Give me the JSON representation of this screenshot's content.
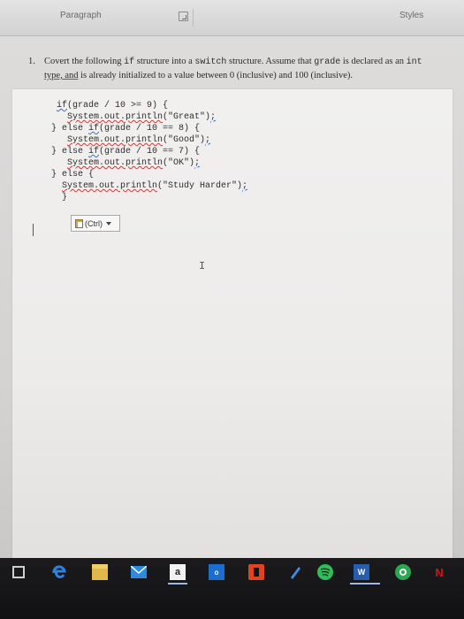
{
  "ribbon": {
    "paragraph_label": "Paragraph",
    "styles_label": "Styles"
  },
  "question": {
    "number": "1.",
    "text_part1": "Covert the following ",
    "if_code": "if",
    "text_part2": " structure into a ",
    "switch_code": "switch",
    "text_part3": " structure. Assume that ",
    "grade_code": "grade",
    "text_part4": " is declared as an ",
    "int_code": "int",
    "text_part5": " type, and",
    "text_part6": " is already initialized to a value between 0 (inclusive) and 100 (inclusive)."
  },
  "code": {
    "line1_kw": "if",
    "line1_rest": "(grade / 10 >= 9) {",
    "line2_call": "System.out.println",
    "line2_arg": "(\"Great\")",
    "line2_end": ";",
    "line3_pre": "} else ",
    "line3_kw": "if",
    "line3_rest": "(grade / 10 == 8) {",
    "line4_call": "System.out.println",
    "line4_arg": "(\"Good\")",
    "line4_end": ";",
    "line5_pre": "} else ",
    "line5_kw": "if",
    "line5_rest": "(grade / 10 == 7) {",
    "line6_call": "System.out.println",
    "line6_arg": "(\"OK\")",
    "line6_end": ";",
    "line7": "} else {",
    "line8_call": "System.out.println",
    "line8_arg": "(\"Study Harder\")",
    "line8_end": ";",
    "line9": "}"
  },
  "paste_options": {
    "label": "(Ctrl)"
  },
  "taskbar": {
    "icons": [
      "task-view-icon",
      "edge-icon",
      "file-explorer-icon",
      "mail-icon",
      "amazon-icon",
      "outlook-icon",
      "office-icon",
      "pen-icon",
      "spotify-icon",
      "word-icon",
      "whatsapp-icon",
      "netflix-icon"
    ],
    "amazon_label": "a",
    "word_label": "W",
    "netflix_label": "N"
  }
}
